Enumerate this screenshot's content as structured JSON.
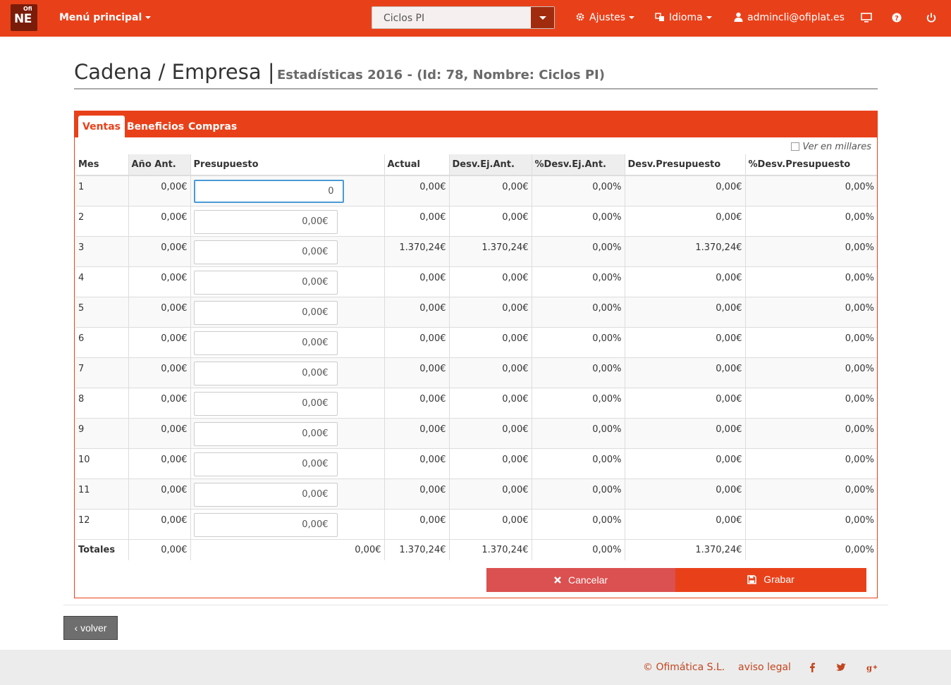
{
  "navbar": {
    "logo_small": "Ofi",
    "logo_big": "NE",
    "main_menu": "Menú principal",
    "company_select": "Ciclos PI",
    "settings": "Ajustes",
    "language": "Idioma",
    "user": "admincli@ofiplat.es",
    "accent_color": "#e8411a"
  },
  "header": {
    "title": "Cadena / Empresa",
    "separator": "|",
    "subtitle": "Estadísticas 2016 - (Id: 78, Nombre: Ciclos PI)"
  },
  "tabs": [
    {
      "label": "Ventas",
      "active": true
    },
    {
      "label": "Beneficios",
      "active": false
    },
    {
      "label": "Compras",
      "active": false
    }
  ],
  "thousands_label": "Ver en millares",
  "table": {
    "columns": [
      "Mes",
      "Año Ant.",
      "Presupuesto",
      "Actual",
      "Desv.Ej.Ant.",
      "%Desv.Ej.Ant.",
      "Desv.Presupuesto",
      "%Desv.Presupuesto"
    ],
    "rows": [
      {
        "mes": "1",
        "prev": "0,00€",
        "budget": "0",
        "actual": "0,00€",
        "dev_prev": "0,00€",
        "pct_prev": "0,00%",
        "dev_budget": "0,00€",
        "pct_budget": "0,00%"
      },
      {
        "mes": "2",
        "prev": "0,00€",
        "budget": "0,00€",
        "actual": "0,00€",
        "dev_prev": "0,00€",
        "pct_prev": "0,00%",
        "dev_budget": "0,00€",
        "pct_budget": "0,00%"
      },
      {
        "mes": "3",
        "prev": "0,00€",
        "budget": "0,00€",
        "actual": "1.370,24€",
        "dev_prev": "1.370,24€",
        "pct_prev": "0,00%",
        "dev_budget": "1.370,24€",
        "pct_budget": "0,00%"
      },
      {
        "mes": "4",
        "prev": "0,00€",
        "budget": "0,00€",
        "actual": "0,00€",
        "dev_prev": "0,00€",
        "pct_prev": "0,00%",
        "dev_budget": "0,00€",
        "pct_budget": "0,00%"
      },
      {
        "mes": "5",
        "prev": "0,00€",
        "budget": "0,00€",
        "actual": "0,00€",
        "dev_prev": "0,00€",
        "pct_prev": "0,00%",
        "dev_budget": "0,00€",
        "pct_budget": "0,00%"
      },
      {
        "mes": "6",
        "prev": "0,00€",
        "budget": "0,00€",
        "actual": "0,00€",
        "dev_prev": "0,00€",
        "pct_prev": "0,00%",
        "dev_budget": "0,00€",
        "pct_budget": "0,00%"
      },
      {
        "mes": "7",
        "prev": "0,00€",
        "budget": "0,00€",
        "actual": "0,00€",
        "dev_prev": "0,00€",
        "pct_prev": "0,00%",
        "dev_budget": "0,00€",
        "pct_budget": "0,00%"
      },
      {
        "mes": "8",
        "prev": "0,00€",
        "budget": "0,00€",
        "actual": "0,00€",
        "dev_prev": "0,00€",
        "pct_prev": "0,00%",
        "dev_budget": "0,00€",
        "pct_budget": "0,00%"
      },
      {
        "mes": "9",
        "prev": "0,00€",
        "budget": "0,00€",
        "actual": "0,00€",
        "dev_prev": "0,00€",
        "pct_prev": "0,00%",
        "dev_budget": "0,00€",
        "pct_budget": "0,00%"
      },
      {
        "mes": "10",
        "prev": "0,00€",
        "budget": "0,00€",
        "actual": "0,00€",
        "dev_prev": "0,00€",
        "pct_prev": "0,00%",
        "dev_budget": "0,00€",
        "pct_budget": "0,00%"
      },
      {
        "mes": "11",
        "prev": "0,00€",
        "budget": "0,00€",
        "actual": "0,00€",
        "dev_prev": "0,00€",
        "pct_prev": "0,00%",
        "dev_budget": "0,00€",
        "pct_budget": "0,00%"
      },
      {
        "mes": "12",
        "prev": "0,00€",
        "budget": "0,00€",
        "actual": "0,00€",
        "dev_prev": "0,00€",
        "pct_prev": "0,00%",
        "dev_budget": "0,00€",
        "pct_budget": "0,00%"
      }
    ],
    "totals": {
      "label": "Totales",
      "prev": "0,00€",
      "budget": "0,00€",
      "actual": "1.370,24€",
      "dev_prev": "1.370,24€",
      "pct_prev": "0,00%",
      "dev_budget": "1.370,24€",
      "pct_budget": "0,00%"
    }
  },
  "buttons": {
    "cancel": "Cancelar",
    "save": "Grabar",
    "back": "volver",
    "cancel_icon": "times-icon",
    "save_icon": "floppy-disk-icon"
  },
  "footer": {
    "copyright": "© Ofimática S.L.",
    "legal": "aviso legal",
    "social": [
      "facebook-icon",
      "twitter-icon",
      "google-plus-icon"
    ]
  }
}
